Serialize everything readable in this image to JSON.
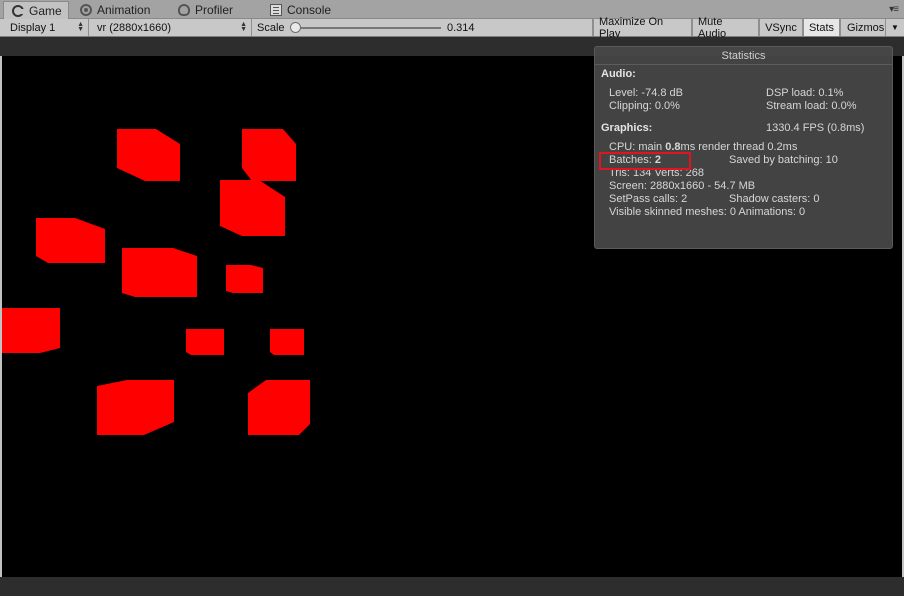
{
  "tabs": [
    {
      "label": "Game",
      "icon": "game-controller-icon"
    },
    {
      "label": "Animation",
      "icon": "animation-icon"
    },
    {
      "label": "Profiler",
      "icon": "profiler-icon"
    },
    {
      "label": "Console",
      "icon": "console-icon"
    }
  ],
  "toolbar": {
    "display": "Display 1",
    "resolution": "vr (2880x1660)",
    "scale_label": "Scale",
    "scale_value": "0.314",
    "maximize_on_play": "Maximize On Play",
    "mute_audio": "Mute Audio",
    "vsync": "VSync",
    "stats": "Stats",
    "gizmos": "Gizmos"
  },
  "colors": {
    "cube": "#ff0000",
    "highlight": "#e0141c",
    "scene_bg": "#000000"
  },
  "stats": {
    "title": "Statistics",
    "audio_heading": "Audio:",
    "level": "Level: -74.8 dB",
    "dsp_load": "DSP load: 0.1%",
    "clipping": "Clipping: 0.0%",
    "stream_load": "Stream load: 0.0%",
    "graphics_heading": "Graphics:",
    "fps": "1330.4 FPS (0.8ms)",
    "cpu_prefix": "CPU: main ",
    "cpu_main": "0.8",
    "cpu_suffix": "ms  render thread 0.2ms",
    "batches_prefix": "Batches: ",
    "batches_value": "2",
    "saved_by_batching": "Saved by batching: 10",
    "tris_verts": "Tris: 134  Verts: 268",
    "screen": "Screen: 2880x1660 - 54.7 MB",
    "setpass": "SetPass calls: 2",
    "shadow_casters": "Shadow casters: 0",
    "skinned_animations": "Visible skinned meshes: 0  Animations: 0"
  }
}
